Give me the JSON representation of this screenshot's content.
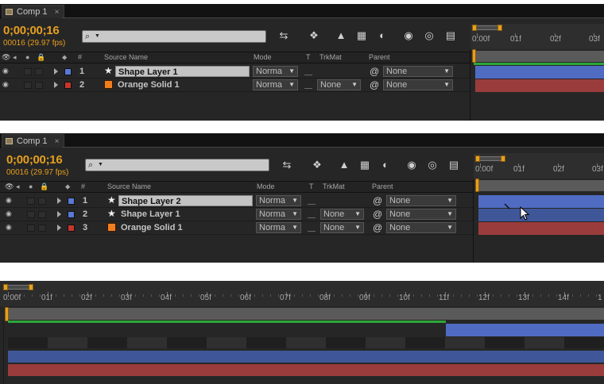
{
  "panels": [
    {
      "tab": {
        "title": "Comp 1",
        "close": "×"
      },
      "timecode": "0;00;00;16",
      "frame_fps": "00016 (29.97 fps)",
      "columns": {
        "source_name": "Source Name",
        "mode": "Mode",
        "t": "T",
        "trkmat": "TrkMat",
        "parent": "Parent",
        "hash": "#"
      },
      "ruler": [
        "0:00f",
        "01f",
        "02f",
        "03f"
      ],
      "layers": [
        {
          "num": "1",
          "name": "Shape Layer 1",
          "type": "shape",
          "color": "#5a79d6",
          "mode": "Norma",
          "trkmat": "",
          "parent": "None",
          "selected": true
        },
        {
          "num": "2",
          "name": "Orange Solid 1",
          "type": "solid",
          "color": "#c4362b",
          "mode": "Norma",
          "trkmat": "None",
          "parent": "None",
          "selected": false
        }
      ]
    },
    {
      "tab": {
        "title": "Comp 1",
        "close": "×"
      },
      "timecode": "0;00;00;16",
      "frame_fps": "00016 (29.97 fps)",
      "columns": {
        "source_name": "Source Name",
        "mode": "Mode",
        "t": "T",
        "trkmat": "TrkMat",
        "parent": "Parent",
        "hash": "#"
      },
      "ruler": [
        "0:00f",
        "01f",
        "02f",
        "03f"
      ],
      "layers": [
        {
          "num": "1",
          "name": "Shape Layer 2",
          "type": "shape",
          "color": "#5a79d6",
          "mode": "Norma",
          "trkmat": "",
          "parent": "None",
          "selected": true
        },
        {
          "num": "2",
          "name": "Shape Layer 1",
          "type": "shape",
          "color": "#5a79d6",
          "mode": "Norma",
          "trkmat": "None",
          "parent": "None",
          "selected": false
        },
        {
          "num": "3",
          "name": "Orange Solid 1",
          "type": "solid",
          "color": "#c4362b",
          "mode": "Norma",
          "trkmat": "None",
          "parent": "None",
          "selected": false
        }
      ]
    }
  ],
  "timeline3": {
    "ruler": [
      "0:00f",
      "01f",
      "02f",
      "03f",
      "04f",
      "05f",
      "06f",
      "07f",
      "08f",
      "09f",
      "10f",
      "11f",
      "12f",
      "13f",
      "14f",
      "1"
    ]
  },
  "icons": {
    "search": "search-icon",
    "toolbar": [
      "comp-mini-flowchart-icon",
      "draft-3d-icon",
      "shy-layers-icon",
      "frame-blending-icon",
      "motion-blur-icon",
      "brainstorm-icon",
      "auto-keyframe-icon",
      "graph-editor-icon"
    ]
  },
  "colors": {
    "timecode": "#e59f1e",
    "shape_layer": "#5a79d6",
    "solid_layer": "#c4362b",
    "work_area": "#2da63a"
  }
}
